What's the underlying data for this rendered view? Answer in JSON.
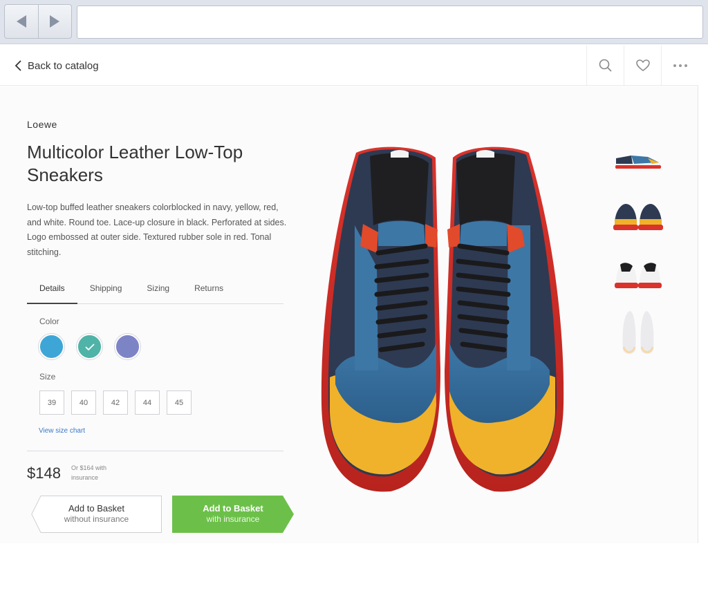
{
  "topbar": {
    "back_label": "Back to catalog"
  },
  "product": {
    "brand": "Loewe",
    "title": "Multicolor Leather Low-Top Sneakers",
    "description": "Low-top buffed leather sneakers colorblocked in navy, yellow, red, and white. Round toe. Lace-up closure in black. Perforated at sides. Logo embossed at outer side. Textured rubber sole in red. Tonal stitching."
  },
  "tabs": [
    {
      "label": "Details",
      "active": true
    },
    {
      "label": "Shipping",
      "active": false
    },
    {
      "label": "Sizing",
      "active": false
    },
    {
      "label": "Returns",
      "active": false
    }
  ],
  "color": {
    "label": "Color",
    "options": [
      {
        "hex": "#3ea6d6",
        "selected": false
      },
      {
        "hex": "#4fb3a8",
        "selected": true
      },
      {
        "hex": "#7d84c6",
        "selected": false
      }
    ]
  },
  "size": {
    "label": "Size",
    "options": [
      "39",
      "40",
      "42",
      "44",
      "45"
    ],
    "chart_link": "View size chart"
  },
  "pricing": {
    "price": "$148",
    "note": "Or $164 with insurance"
  },
  "buttons": {
    "without": {
      "main": "Add to Basket",
      "sub": "without insurance"
    },
    "with": {
      "main": "Add to Basket",
      "sub": "with insurance"
    }
  },
  "colors": {
    "accent_green": "#6cc04a",
    "link_blue": "#3b78c4"
  },
  "icons": {
    "back": "chevron-left-icon",
    "search": "search-icon",
    "favorite": "heart-icon",
    "more": "more-dots-icon"
  }
}
